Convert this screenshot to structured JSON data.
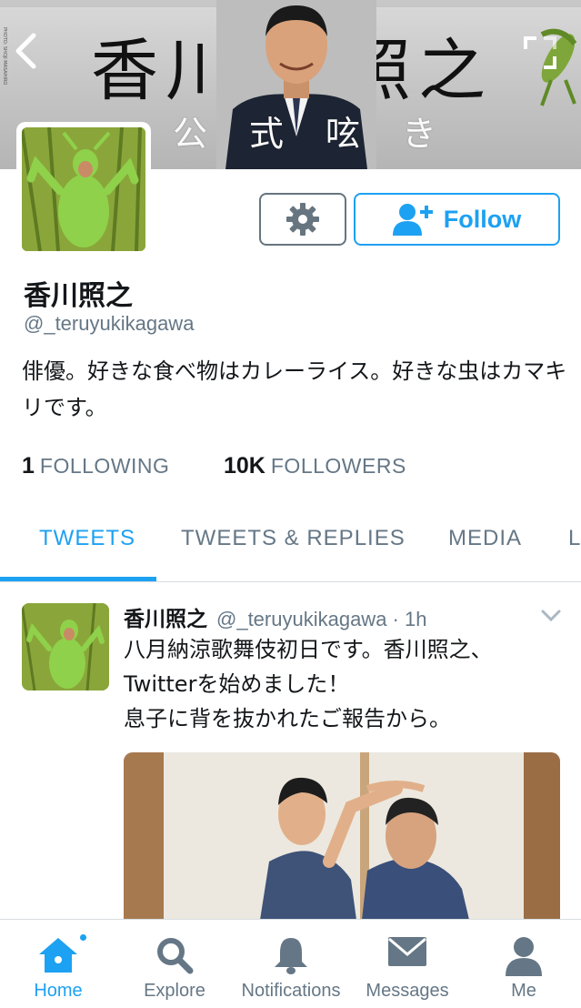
{
  "colors": {
    "accent": "#1da1f2",
    "text_primary": "#14171a",
    "text_secondary": "#657786",
    "divider": "#d8dde1"
  },
  "banner": {
    "calligraphy_left": "香川",
    "calligraphy_right": "照之",
    "subtitle": "公式呟き",
    "photo_credit": "PHOTO: SHOJI MASAHIRO"
  },
  "profile": {
    "display_name": "香川照之",
    "handle": "@_teruyukikagawa",
    "bio": "俳優。好きな食べ物はカレーライス。好きな虫はカマキリです。",
    "follow_label": "Follow",
    "stats": {
      "following_count": "1",
      "following_label": "FOLLOWING",
      "followers_count": "10K",
      "followers_label": "FOLLOWERS"
    }
  },
  "tabs": {
    "items": [
      {
        "label": "TWEETS",
        "active": true
      },
      {
        "label": "TWEETS & REPLIES",
        "active": false
      },
      {
        "label": "MEDIA",
        "active": false
      },
      {
        "label": "L",
        "active": false
      }
    ]
  },
  "tweet": {
    "author_name": "香川照之",
    "meta": "@_teruyukikagawa · 1h",
    "text_line1": "八月納涼歌舞伎初日です。香川照之、",
    "text_line2": "Twitterを始めました！",
    "text_line3": "息子に背を抜かれたご報告から。"
  },
  "bottom_nav": {
    "items": [
      {
        "label": "Home",
        "icon": "home-icon",
        "active": true
      },
      {
        "label": "Explore",
        "icon": "search-icon",
        "active": false
      },
      {
        "label": "Notifications",
        "icon": "bell-icon",
        "active": false
      },
      {
        "label": "Messages",
        "icon": "envelope-icon",
        "active": false
      },
      {
        "label": "Me",
        "icon": "person-icon",
        "active": false
      }
    ]
  }
}
